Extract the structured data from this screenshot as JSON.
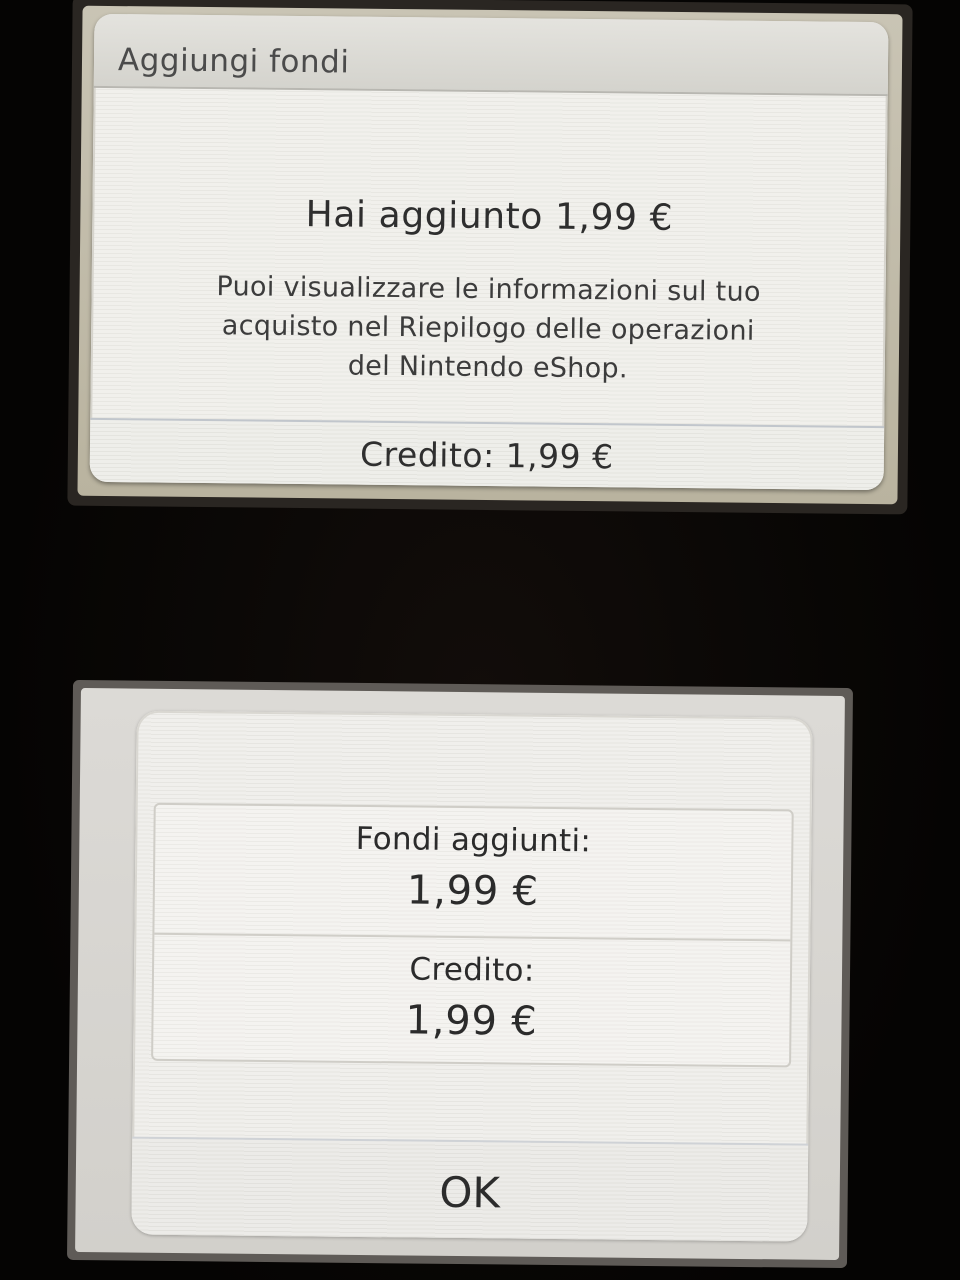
{
  "top_screen": {
    "title": "Aggiungi fondi",
    "headline": "Hai aggiunto 1,99 €",
    "info_lines": [
      "Puoi visualizzare le informazioni sul tuo",
      "acquisto nel Riepilogo delle operazioni",
      "del Nintendo eShop."
    ],
    "balance": "Credito: 1,99 €"
  },
  "bottom_screen": {
    "funds_added_label": "Fondi aggiunti:",
    "funds_added_value": "1,99 €",
    "balance_label": "Credito:",
    "balance_value": "1,99 €",
    "ok_label": "OK"
  }
}
